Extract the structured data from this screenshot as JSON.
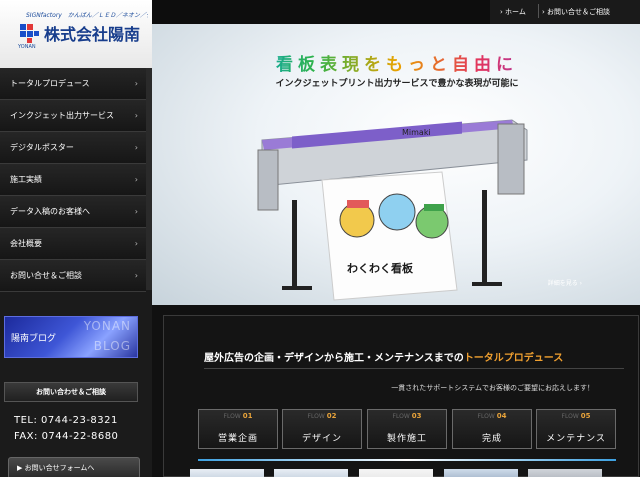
{
  "logo": {
    "tagline": "SIGNfactory　かんばん／ＬＥＤ／ネオン／デジサイン",
    "company": "株式会社陽南",
    "mark_caption": "YONAN"
  },
  "topbar": {
    "home": "ホーム",
    "contact": "お問い合せ＆ご相談"
  },
  "nav": {
    "items": [
      {
        "label": "トータルプロデュース",
        "arrow": "›"
      },
      {
        "label": "インクジェット出力サービス",
        "arrow": "›"
      },
      {
        "label": "デジタルポスター",
        "arrow": "›"
      },
      {
        "label": "施工実績",
        "arrow": "›"
      },
      {
        "label": "データ入稿のお客様へ",
        "arrow": "›"
      },
      {
        "label": "会社概要",
        "arrow": "›"
      },
      {
        "label": "お問い合せ＆ご相談",
        "arrow": "›"
      }
    ]
  },
  "blog": {
    "title": "陽南ブログ",
    "en1": "YONAN",
    "en2": "BLOG"
  },
  "contact": {
    "heading": "お問い合わせ＆ご相談",
    "tel": "TEL: 0744-23-8321",
    "fax": "FAX: 0744-22-8680",
    "form_button": "▶ お問い合せフォームへ"
  },
  "hero": {
    "title": "看板表現をもっと自由に",
    "subtitle": "インクジェットプリント出力サービスで豊かな表現が可能に",
    "more_link": "詳細を見る ›",
    "printer_brand": "Mimaki",
    "banner_text": "わくわく看板"
  },
  "main": {
    "heading_pre": "屋外広告の企画・デザインから施工・メンテナンスまでの",
    "heading_hl": "トータルプロデュース",
    "subtitle": "一貫されたサポートシステムでお客様のご要望にお応えします！",
    "flows": [
      {
        "tag": "FLOW",
        "num": "01",
        "label": "営業企画"
      },
      {
        "tag": "FLOW",
        "num": "02",
        "label": "デザイン"
      },
      {
        "tag": "FLOW",
        "num": "03",
        "label": "製作施工"
      },
      {
        "tag": "FLOW",
        "num": "04",
        "label": "完成"
      },
      {
        "tag": "FLOW",
        "num": "05",
        "label": "メンテナンス"
      }
    ]
  },
  "colors": {
    "accent_orange": "#f0a030",
    "logo_blue": "#173d8c",
    "blog_blue": "#3e56d6"
  }
}
